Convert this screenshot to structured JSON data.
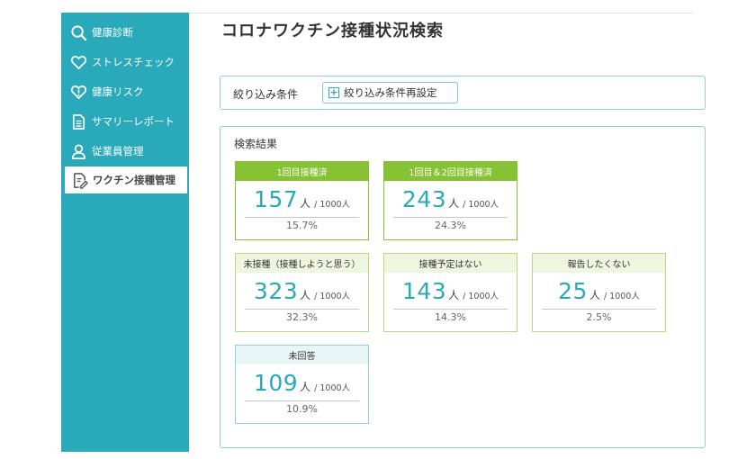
{
  "sidebar": {
    "items": [
      {
        "label": "健康診断",
        "icon": "search-icon"
      },
      {
        "label": "ストレスチェック",
        "icon": "heart-icon"
      },
      {
        "label": "健康リスク",
        "icon": "heart-risk-icon"
      },
      {
        "label": "サマリーレポート",
        "icon": "document-icon"
      },
      {
        "label": "従業員管理",
        "icon": "user-icon"
      },
      {
        "label": "ワクチン接種管理",
        "icon": "edit-document-icon",
        "active": true
      }
    ],
    "color": "#29a9b9"
  },
  "page": {
    "title": "コロナワクチン接種状況検索"
  },
  "filter": {
    "label": "絞り込み条件",
    "reset_button": "絞り込み条件再設定"
  },
  "results": {
    "label": "検索結果",
    "cards": [
      {
        "title": "1回目接種済",
        "count": "157",
        "unit": "人",
        "total": "/ 1000人",
        "percent": "15.7%"
      },
      {
        "title": "1回目＆2回目接種済",
        "count": "243",
        "unit": "人",
        "total": "/ 1000人",
        "percent": "24.3%"
      },
      {
        "title": "未接種（接種しようと思う）",
        "count": "323",
        "unit": "人",
        "total": "/ 1000人",
        "percent": "32.3%"
      },
      {
        "title": "接種予定はない",
        "count": "143",
        "unit": "人",
        "total": "/ 1000人",
        "percent": "14.3%"
      },
      {
        "title": "報告したくない",
        "count": "25",
        "unit": "人",
        "total": "/ 1000人",
        "percent": "2.5%"
      },
      {
        "title": "未回答",
        "count": "109",
        "unit": "人",
        "total": "/ 1000人",
        "percent": "10.9%"
      }
    ]
  },
  "colors": {
    "accent": "#29a9b9",
    "green": "#87c234",
    "green_light": "#eef6df"
  }
}
